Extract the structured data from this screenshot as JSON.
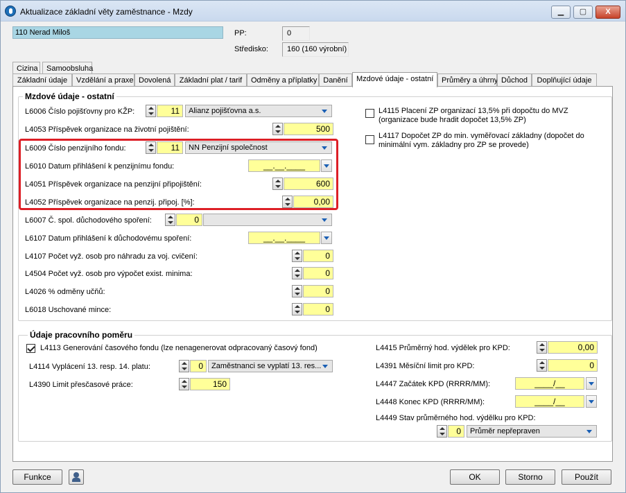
{
  "window": {
    "title": "Aktualizace základní věty zaměstnance - Mzdy",
    "min_glyph": "▁",
    "max_glyph": "▢",
    "close_glyph": "X"
  },
  "employee": {
    "name": "110  Nerad Miloš",
    "pp_label": "PP:",
    "pp_value": "0",
    "stredisko_label": "Středisko:",
    "stredisko_value": "160 (160 výrobní)"
  },
  "tabs_row1": [
    "Cizina",
    "Samoobsluha"
  ],
  "tabs_row2": [
    "Základní údaje",
    "Vzdělání a praxe",
    "Dovolená",
    "Základní plat / tarif",
    "Odměny a příplatky",
    "Danění",
    "Mzdové údaje - ostatní",
    "Průměry a úhrny",
    "Důchod",
    "Doplňující údaje"
  ],
  "active_tab": "Mzdové údaje - ostatní",
  "group1": {
    "title": "Mzdové údaje - ostatní",
    "l6006": {
      "label": "L6006 Číslo pojišťovny pro KŽP:",
      "num": "11",
      "combo": "Alianz pojišťovna a.s."
    },
    "l4053": {
      "label": "L4053 Příspěvek organizace na životní pojištění:",
      "value": "500"
    },
    "l6009": {
      "label": "L6009 Číslo penzijního fondu:",
      "num": "11",
      "combo": "NN Penzijní společnost"
    },
    "l6010": {
      "label": "L6010 Datum přihlášení k penzijnímu fondu:",
      "value": "__.__.____"
    },
    "l4051": {
      "label": "L4051 Příspěvek organizace na penzijní připojištění:",
      "value": "600"
    },
    "l4052": {
      "label": "L4052 Příspěvek organizace na penzij. připoj. [%]:",
      "value": "0,00"
    },
    "l6007": {
      "label": "L6007 Č. spol. důchodového spoření:",
      "num": "0",
      "combo": ""
    },
    "l6107": {
      "label": "L6107 Datum přihlášení k důchodovému spoření:",
      "value": "__.__.____"
    },
    "l4107": {
      "label": "L4107 Počet vyž. osob pro náhradu za voj. cvičení:",
      "value": "0"
    },
    "l4504": {
      "label": "L4504 Počet vyž. osob pro výpočet exist. minima:",
      "value": "0"
    },
    "l4026": {
      "label": "L4026 % odměny učňů:",
      "value": "0"
    },
    "l6018": {
      "label": "L6018 Uschované mince:",
      "value": "0"
    },
    "l4115": {
      "line1": "L4115 Placení ZP organizací 13,5% při dopočtu do MVZ",
      "line2": "(organizace bude hradit dopočet 13,5% ZP)"
    },
    "l4117": {
      "line1": "L4117 Dopočet ZP do min. vyměřovací základny (dopočet do",
      "line2": "minimální vym. základny pro ZP se provede)"
    }
  },
  "group2": {
    "title": "Údaje pracovního poměru",
    "l4113": {
      "label": "L4113 Generování časového fondu (lze nenagenerovat odpracovaný časový fond)",
      "checked": true
    },
    "l4114": {
      "label": "L4114 Vyplácení 13. resp. 14. platu:",
      "num": "0",
      "combo": "Zaměstnanci se vyplatí 13. res..."
    },
    "l4390": {
      "label": "L4390 Limit přesčasové práce:",
      "value": "150"
    },
    "l4415": {
      "label": "L4415 Průměrný hod. výdělek pro KPD:",
      "value": "0,00"
    },
    "l4391": {
      "label": "L4391 Měsíční limit pro KPD:",
      "value": "0"
    },
    "l4447": {
      "label": "L4447 Začátek KPD (RRRR/MM):",
      "value": "____/__"
    },
    "l4448": {
      "label": "L4448 Konec KPD (RRRR/MM):",
      "value": "____/__"
    },
    "l4449": {
      "label": "L4449 Stav průměrného hod. výdělku pro KPD:",
      "num": "0",
      "combo": "Průměr nepřepraven"
    }
  },
  "footer": {
    "funkce": "Funkce",
    "ok": "OK",
    "storno": "Storno",
    "pouzit": "Použít"
  },
  "colors": {
    "highlight": "#dd1f26",
    "input_yellow": "#ffff99",
    "name_bg": "#a9d6e4",
    "arrow_blue": "#1a5fb4"
  }
}
